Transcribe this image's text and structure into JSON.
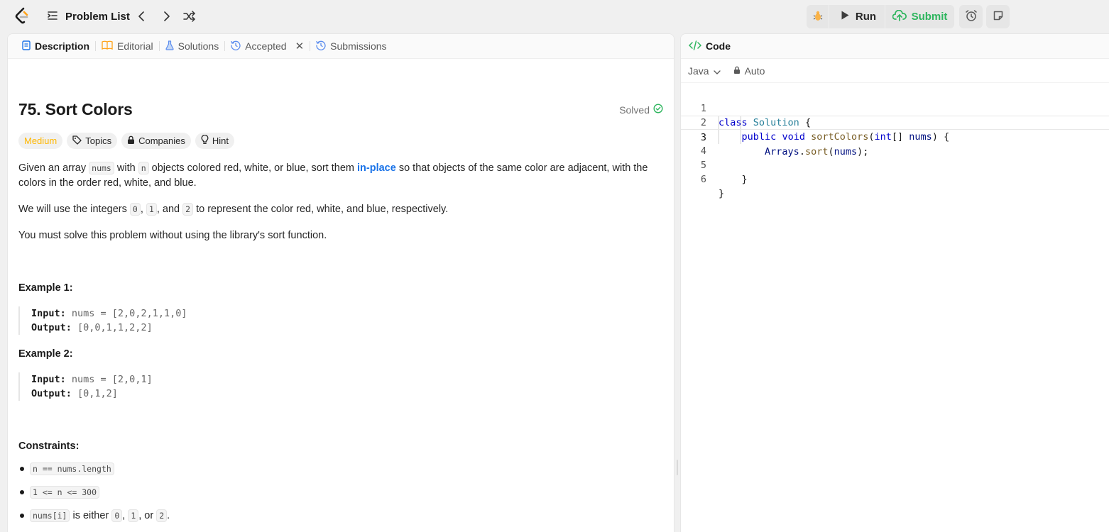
{
  "topbar": {
    "problem_list_label": "Problem List",
    "run_label": "Run",
    "submit_label": "Submit"
  },
  "left": {
    "tabs": [
      {
        "label": "Description"
      },
      {
        "label": "Editorial"
      },
      {
        "label": "Solutions"
      },
      {
        "label": "Accepted"
      },
      {
        "label": "Submissions"
      }
    ],
    "title": "75. Sort Colors",
    "status": "Solved",
    "tags": {
      "difficulty": "Medium",
      "topics": "Topics",
      "companies": "Companies",
      "hint": "Hint"
    },
    "description": {
      "p1_a": "Given an array ",
      "p1_code1": "nums",
      "p1_b": " with ",
      "p1_code2": "n",
      "p1_c": " objects colored red, white, or blue, sort them ",
      "p1_link": "in-place",
      "p1_d": " so that objects of the same color are adjacent, with the colors in the order red, white, and blue.",
      "p2_a": "We will use the integers ",
      "p2_code0": "0",
      "p2_b": ", ",
      "p2_code1": "1",
      "p2_c": ", and ",
      "p2_code2": "2",
      "p2_d": " to represent the color red, white, and blue, respectively.",
      "p3": "You must solve this problem without using the library's sort function."
    },
    "examples": [
      {
        "heading": "Example 1:",
        "input_label": "Input:",
        "input": " nums = [2,0,2,1,1,0]",
        "output_label": "Output:",
        "output": " [0,0,1,1,2,2]"
      },
      {
        "heading": "Example 2:",
        "input_label": "Input:",
        "input": " nums = [2,0,1]",
        "output_label": "Output:",
        "output": " [0,1,2]"
      }
    ],
    "constraints_heading": "Constraints:",
    "constraints": {
      "c1_code": "n == nums.length",
      "c2_code": "1 <= n <= 300",
      "c3_code": "nums[i]",
      "c3_text_a": " is either ",
      "c3_code0": "0",
      "c3_sep": ", ",
      "c3_code1": "1",
      "c3_text_b": ", or ",
      "c3_code2": "2",
      "c3_end": "."
    }
  },
  "right": {
    "header_label": "Code",
    "language": "Java",
    "mode": "Auto",
    "line_numbers": [
      "1",
      "2",
      "3",
      "4",
      "5",
      "6"
    ]
  },
  "colors": {
    "accent_green": "#2db55d",
    "medium_yellow": "#ffb700",
    "link_blue": "#1a73e8"
  }
}
